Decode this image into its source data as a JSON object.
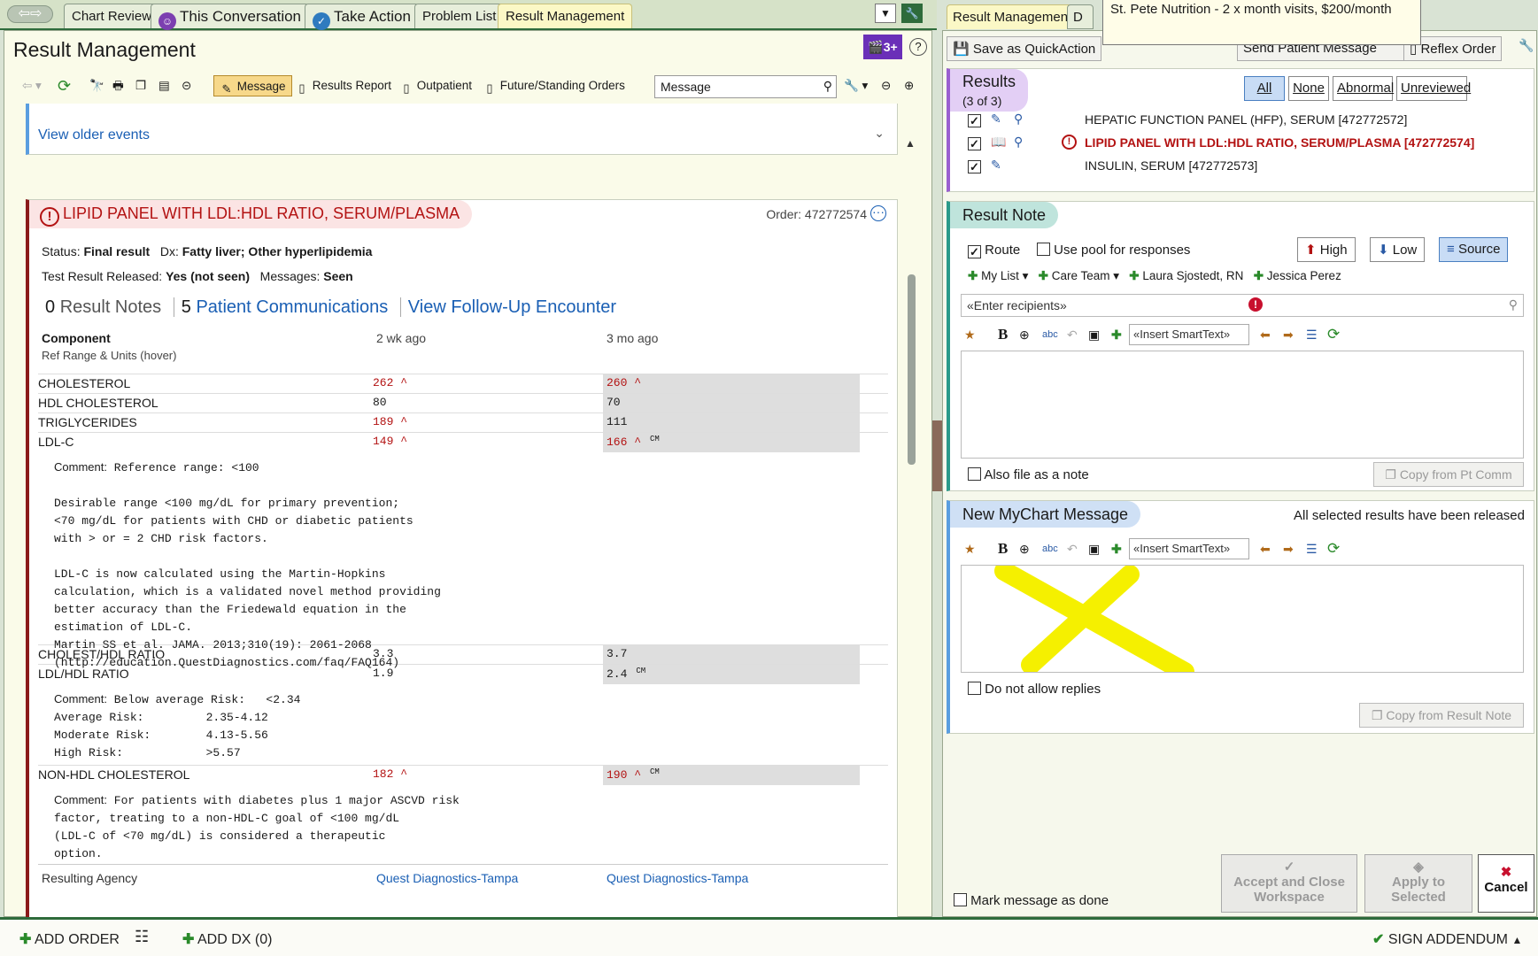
{
  "tabs": [
    {
      "label": "Chart Review"
    },
    {
      "label": "This Conversation"
    },
    {
      "label": "Take Action"
    },
    {
      "label": "Problem List"
    },
    {
      "label": "Result Management"
    }
  ],
  "left": {
    "title": "Result Management",
    "badge": "3+",
    "toolbar": {
      "message": "Message",
      "results_report": "Results Report",
      "outpatient": "Outpatient",
      "future_orders": "Future/Standing Orders",
      "search_value": "Message"
    },
    "older_events": "View older events",
    "result": {
      "title": "LIPID PANEL WITH LDL:HDL RATIO, SERUM/PLASMA",
      "order": "Order: 472772574",
      "status_label": "Status:",
      "status_value": "Final result",
      "dx_label": "Dx:",
      "dx_value": "Fatty liver; Other hyperlipidemia",
      "released_label": "Test Result Released:",
      "released_value": "Yes (not seen)",
      "messages_label": "Messages:",
      "messages_value": "Seen",
      "notes_count": "0",
      "notes_label": "Result Notes",
      "comms_count": "5",
      "comms_label": "Patient Communications",
      "followup": "View Follow-Up Encounter",
      "col_component": "Component",
      "col_ref": "Ref Range & Units (hover)",
      "col_1": "2 wk ago",
      "col_2": "3 mo ago",
      "rows": [
        {
          "name": "CHOLESTEROL",
          "v1": "262 ^",
          "v2": "260 ^"
        },
        {
          "name": "HDL CHOLESTEROL",
          "v1": "80",
          "v2": "70"
        },
        {
          "name": "TRIGLYCERIDES",
          "v1": "189 ^",
          "v2": "111"
        },
        {
          "name": "LDL-C",
          "v1": "149 ^",
          "v2": "166 ^",
          "v2_cm": "CM"
        },
        {
          "name": "CHOLEST/HDL RATIO",
          "v1": "3.3",
          "v2": "3.7"
        },
        {
          "name": "LDL/HDL RATIO",
          "v1": "1.9",
          "v2": "2.4",
          "v2_cm": "CM"
        },
        {
          "name": "NON-HDL CHOLESTEROL",
          "v1": "182 ^",
          "v2": "190 ^",
          "v2_cm": "CM"
        }
      ],
      "comment_label": "Comment:",
      "comment_ldl": "Reference range: <100\n\nDesirable range <100 mg/dL for primary prevention;\n<70 mg/dL for patients with CHD or diabetic patients\nwith > or = 2 CHD risk factors.\n\nLDL-C is now calculated using the Martin-Hopkins\ncalculation, which is a validated novel method providing\nbetter accuracy than the Friedewald equation in the\nestimation of LDL-C.\nMartin SS et al. JAMA. 2013;310(19): 2061-2068\n(http://education.QuestDiagnostics.com/faq/FAQ164)",
      "comment_ratio": "Below average Risk:   <2.34\nAverage Risk:         2.35-4.12\nModerate Risk:        4.13-5.56\nHigh Risk:            >5.57",
      "comment_nonhdl": "For patients with diabetes plus 1 major ASCVD risk\nfactor, treating to a non-HDL-C goal of <100 mg/dL\n(LDL-C of <70 mg/dL) is considered a therapeutic\noption.",
      "agency_label": "Resulting Agency",
      "agency_1": "Quest Diagnostics-Tampa",
      "agency_2": "Quest Diagnostics-Tampa"
    }
  },
  "right": {
    "tab_active": "Result Management",
    "tab_other": "D",
    "tooltip": "St. Pete Nutrition - 2 x month visits, $200/month",
    "save_quickaction": "Save as QuickAction",
    "send_patient_message": "Send Patient Message",
    "reflex_order": "Reflex Order",
    "results_title": "Results",
    "results_count": "(3 of 3)",
    "filters": [
      "All",
      "None",
      "Abnormal",
      "Unreviewed"
    ],
    "results": [
      {
        "name": "HEPATIC FUNCTION PANEL (HFP), SERUM [472772572]",
        "abnormal": false
      },
      {
        "name": "LIPID PANEL WITH LDL:HDL RATIO, SERUM/PLASMA [472772574]",
        "abnormal": true
      },
      {
        "name": "INSULIN, SERUM [472772573]",
        "abnormal": false
      }
    ],
    "note_title": "Result Note",
    "route": "Route",
    "use_pool": "Use pool for responses",
    "high": "High",
    "low": "Low",
    "source": "Source",
    "recipients": {
      "my_list": "My List",
      "care_team": "Care Team",
      "r1": "Laura Sjostedt, RN",
      "r2": "Jessica Perez"
    },
    "recipient_placeholder": "«Enter recipients»",
    "insert_smarttext": "«Insert SmartText»",
    "also_file": "Also file as a note",
    "copy_from_pt": "Copy from Pt Comm",
    "mychart_title": "New MyChart Message",
    "all_released": "All selected results have been released",
    "no_replies": "Do not allow replies",
    "copy_from_note": "Copy from Result Note",
    "mark_done": "Mark message as done",
    "accept_close": "Accept and Close Workspace",
    "apply_selected": "Apply to Selected",
    "cancel": "Cancel"
  },
  "bottom": {
    "add_order": "ADD ORDER",
    "add_dx": "ADD DX (0)",
    "sign": "SIGN ADDENDUM"
  }
}
